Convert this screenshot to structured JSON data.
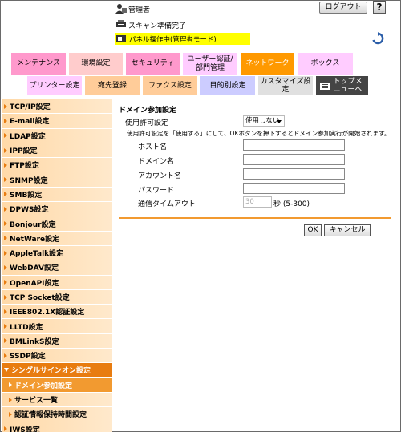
{
  "header": {
    "admin_label": "管理者",
    "logout_label": "ログアウト",
    "help_label": "?",
    "scan_status": "スキャン準備完了",
    "panel_status": "パネル操作中(管理者モード)"
  },
  "main_tabs": [
    {
      "label": "メンテナンス",
      "color": "#ff99cc"
    },
    {
      "label": "環境設定",
      "color": "#ffcccc"
    },
    {
      "label": "セキュリティ",
      "color": "#ff99cc"
    },
    {
      "label": "ユーザー認証/部門管理",
      "color": "#ffccff"
    },
    {
      "label": "ネットワーク",
      "color": "#ff9900"
    },
    {
      "label": "ボックス",
      "color": "#ffccff"
    }
  ],
  "sub_tabs": [
    {
      "label": "プリンター設定",
      "color": "#ffccff"
    },
    {
      "label": "宛先登録",
      "color": "#ffcc99"
    },
    {
      "label": "ファクス設定",
      "color": "#ffcc99"
    },
    {
      "label": "目的別設定",
      "color": "#ccccff"
    },
    {
      "label": "カスタマイズ設定",
      "color": "#e0e0e0"
    },
    {
      "label": "トップメニューへ",
      "color": "#444444"
    }
  ],
  "sidebar": {
    "items": [
      {
        "label": "TCP/IP設定",
        "type": "cat"
      },
      {
        "label": "E-mail設定",
        "type": "cat"
      },
      {
        "label": "LDAP設定",
        "type": "cat"
      },
      {
        "label": "IPP設定",
        "type": "cat"
      },
      {
        "label": "FTP設定",
        "type": "cat"
      },
      {
        "label": "SNMP設定",
        "type": "cat"
      },
      {
        "label": "SMB設定",
        "type": "cat"
      },
      {
        "label": "DPWS設定",
        "type": "cat"
      },
      {
        "label": "Bonjour設定",
        "type": "cat"
      },
      {
        "label": "NetWare設定",
        "type": "cat"
      },
      {
        "label": "AppleTalk設定",
        "type": "cat"
      },
      {
        "label": "WebDAV設定",
        "type": "cat"
      },
      {
        "label": "OpenAPI設定",
        "type": "cat"
      },
      {
        "label": "TCP Socket設定",
        "type": "cat"
      },
      {
        "label": "IEEE802.1X認証設定",
        "type": "cat"
      },
      {
        "label": "LLTD設定",
        "type": "cat"
      },
      {
        "label": "BMLinkS設定",
        "type": "cat"
      },
      {
        "label": "SSDP設定",
        "type": "cat"
      },
      {
        "label": "シングルサインオン設定",
        "type": "active-cat"
      },
      {
        "label": "ドメイン参加設定",
        "type": "sub-active"
      },
      {
        "label": "サービス一覧",
        "type": "sub"
      },
      {
        "label": "認証情報保持時間設定",
        "type": "sub"
      },
      {
        "label": "IWS設定",
        "type": "cat"
      }
    ]
  },
  "form": {
    "title": "ドメイン参加設定",
    "permission_label": "使用許可設定",
    "permission_value": "使用しない",
    "note": "使用許可設定を「使用する」にして、OKボタンを押下するとドメイン参加実行が開始されます。",
    "host_label": "ホスト名",
    "domain_label": "ドメイン名",
    "account_label": "アカウント名",
    "password_label": "パスワード",
    "timeout_label": "通信タイムアウト",
    "timeout_value": "30",
    "timeout_suffix": "秒 (5-300)",
    "ok_label": "OK",
    "cancel_label": "キャンセル"
  },
  "colors": {
    "accent": "#e87c10",
    "highlight": "#ffff00"
  }
}
